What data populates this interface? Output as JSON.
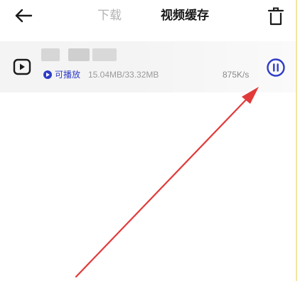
{
  "header": {
    "tab_download": "下载",
    "tab_cache": "视频缓存",
    "back_icon": "arrow-left",
    "delete_icon": "trash"
  },
  "item": {
    "status_label": "可播放",
    "size": "15.04MB/33.32MB",
    "speed": "875K/s",
    "video_icon": "video-play-square",
    "pause_icon": "pause-circle"
  },
  "colors": {
    "accent": "#2f3cc7",
    "annotation_arrow": "#e23a3a",
    "row_background": "#f4f4f4",
    "inactive_tab": "#b3b3b3"
  }
}
